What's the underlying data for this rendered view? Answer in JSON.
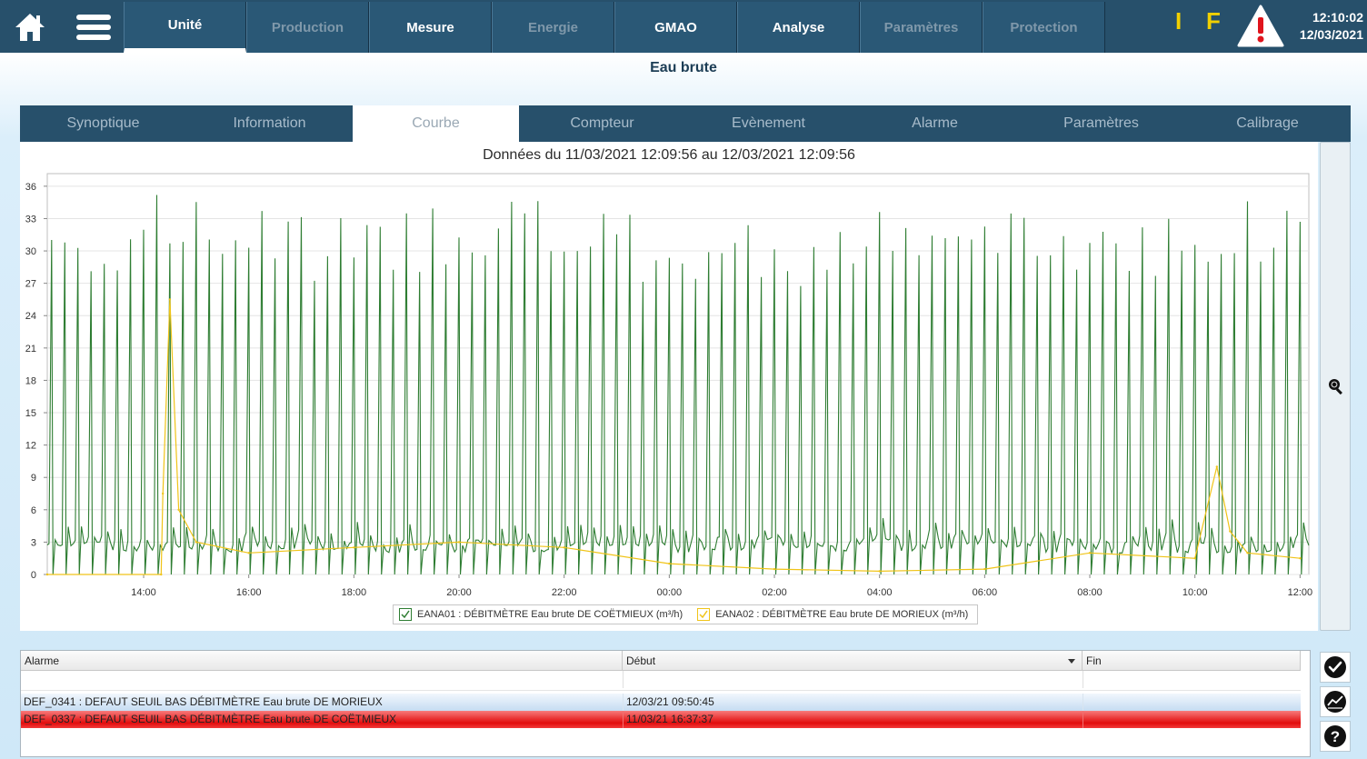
{
  "header": {
    "nav": [
      {
        "label": "Unité",
        "state": "active"
      },
      {
        "label": "Production",
        "state": "disabled"
      },
      {
        "label": "Mesure",
        "state": "enabled"
      },
      {
        "label": "Energie",
        "state": "disabled"
      },
      {
        "label": "GMAO",
        "state": "enabled"
      },
      {
        "label": "Analyse",
        "state": "enabled"
      },
      {
        "label": "Paramètres",
        "state": "disabled"
      },
      {
        "label": "Protection",
        "state": "disabled"
      }
    ],
    "indicator_i": "I",
    "indicator_f": "F",
    "time": "12:10:02",
    "date": "12/03/2021",
    "icons": [
      "home-icon",
      "menu-icon",
      "alert-triangle-icon"
    ]
  },
  "page_title": "Eau brute",
  "tabs": [
    {
      "label": "Synoptique",
      "active": false
    },
    {
      "label": "Information",
      "active": false
    },
    {
      "label": "Courbe",
      "active": true
    },
    {
      "label": "Compteur",
      "active": false
    },
    {
      "label": "Evènement",
      "active": false
    },
    {
      "label": "Alarme",
      "active": false
    },
    {
      "label": "Paramètres",
      "active": false
    },
    {
      "label": "Calibrage",
      "active": false
    }
  ],
  "chart_data": {
    "type": "line",
    "title": "Données du 11/03/2021 12:09:56 au 12/03/2021 12:09:56",
    "xlabel": "",
    "ylabel": "",
    "x_range": [
      "11/03/2021 12:09:56",
      "12/03/2021 12:09:56"
    ],
    "ylim": [
      0,
      37
    ],
    "y_ticks": [
      0,
      3,
      6,
      9,
      12,
      15,
      18,
      21,
      24,
      27,
      30,
      33,
      36
    ],
    "x_ticks": [
      "14:00",
      "16:00",
      "18:00",
      "20:00",
      "22:00",
      "00:00",
      "02:00",
      "04:00",
      "06:00",
      "08:00",
      "10:00",
      "12:00"
    ],
    "grid": true,
    "series": [
      {
        "name": "EANA01 : DÉBITMÈTRE Eau brute DE COËTMIEUX (m³/h)",
        "color": "#2e7d32",
        "description_points": [
          [
            "12:10",
            34
          ],
          [
            "14:30",
            35.5
          ],
          [
            "16:00",
            35
          ],
          [
            "18:00",
            33
          ],
          [
            "20:00",
            36
          ],
          [
            "21:00",
            36.5
          ],
          [
            "22:00",
            34
          ],
          [
            "00:00",
            33
          ],
          [
            "02:00",
            33
          ],
          [
            "04:00",
            34
          ],
          [
            "06:00",
            34
          ],
          [
            "08:00",
            34
          ],
          [
            "10:00",
            35
          ],
          [
            "12:00",
            35
          ]
        ],
        "baseline": 2,
        "pattern": "periodic spikes ~ every 15 min between 0 and 30-36"
      },
      {
        "name": "EANA02 : DÉBITMÈTRE Eau brute DE MORIEUX (m³/h)",
        "color": "#f0c419",
        "points": [
          [
            "12:10",
            0
          ],
          [
            "14:20",
            0
          ],
          [
            "14:22",
            7.5
          ],
          [
            "14:30",
            25.5
          ],
          [
            "14:40",
            6
          ],
          [
            "15:00",
            3
          ],
          [
            "16:00",
            2
          ],
          [
            "18:00",
            2.5
          ],
          [
            "20:00",
            3
          ],
          [
            "22:00",
            2.5
          ],
          [
            "00:00",
            1
          ],
          [
            "02:00",
            0.5
          ],
          [
            "04:00",
            0.3
          ],
          [
            "06:00",
            0.5
          ],
          [
            "08:00",
            2
          ],
          [
            "10:00",
            1.5
          ],
          [
            "10:25",
            10
          ],
          [
            "10:40",
            4
          ],
          [
            "11:00",
            2
          ],
          [
            "12:00",
            1.5
          ]
        ]
      }
    ],
    "legend_placement": "bottom"
  },
  "alarm_table": {
    "columns": [
      "Alarme",
      "Début",
      "Fin"
    ],
    "rows": [
      {
        "alarme": "DEF_0341 : DEFAUT SEUIL BAS DÉBITMÈTRE Eau brute DE MORIEUX",
        "debut": "12/03/21 09:50:45",
        "fin": "",
        "color": "#c6dcf2"
      },
      {
        "alarme": "DEF_0337 : DEFAUT SEUIL BAS DÉBITMÈTRE Eau brute DE COËTMIEUX",
        "debut": "11/03/21 16:37:37",
        "fin": "",
        "color": "#e20d0d"
      }
    ]
  },
  "actions": [
    "check-icon",
    "chart-icon",
    "help-icon"
  ]
}
